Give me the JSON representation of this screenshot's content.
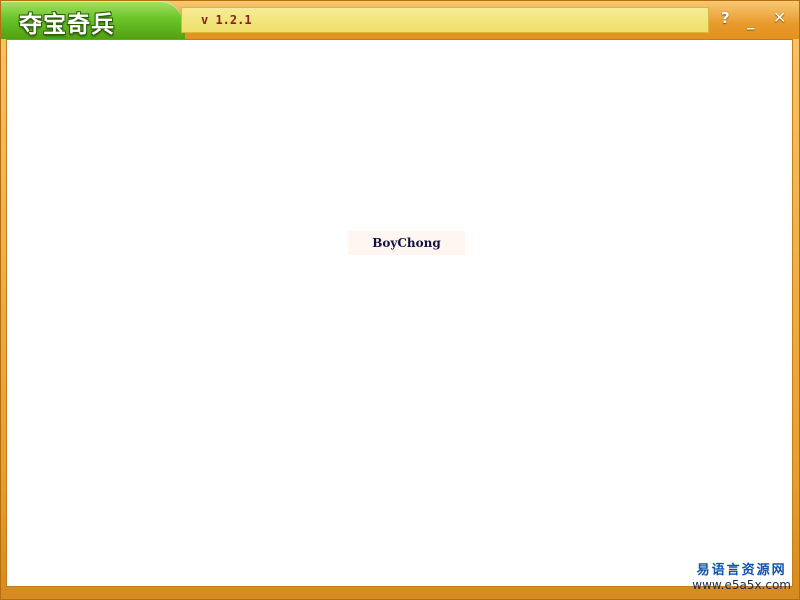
{
  "window": {
    "title": "夺宝奇兵",
    "version": "v 1.2.1"
  },
  "controls": {
    "help": "?",
    "minimize": "_",
    "close": "✕"
  },
  "content": {
    "author_label": "BoyChong"
  },
  "watermark": {
    "name": "易语言资源网",
    "url": "www.e5a5x.com"
  },
  "colors": {
    "frame": "#e99d2c",
    "title_tab": "#6cc52a",
    "version_strip": "#efdf69",
    "version_text": "#8d1c1c"
  }
}
